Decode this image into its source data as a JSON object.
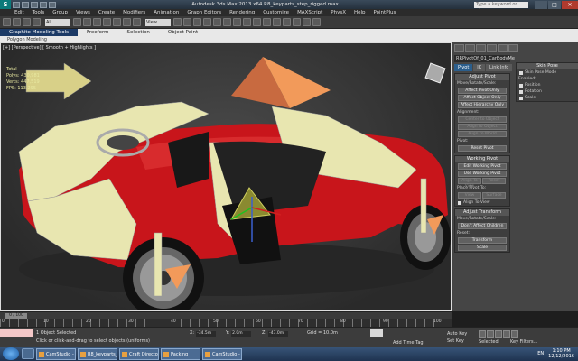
{
  "window": {
    "title": "Autodesk 3ds Max 2013 x64   R8_keyparts_step_rigged.max",
    "search_placeholder": "Type a keyword or phrase",
    "minimize": "–",
    "maximize": "□",
    "close": "✕"
  },
  "menu": [
    "Edit",
    "Tools",
    "Group",
    "Views",
    "Create",
    "Modifiers",
    "Animation",
    "Graph Editors",
    "Rendering",
    "Customize",
    "MAXScript",
    "PhysX",
    "Help",
    "PointPlus"
  ],
  "toolbar": {
    "dropdown_all": "All",
    "dropdown_view": "View"
  },
  "ribbon": {
    "tabs": [
      "Graphite Modeling Tools",
      "Freeform",
      "Selection",
      "Object Paint"
    ],
    "sub": "Polygon Modeling"
  },
  "viewport": {
    "label": "[+] [Perspective] [ Smooth + Highlights ]",
    "stats": {
      "total_label": "Total",
      "polys_label": "Polys:",
      "polys_value": "430,981",
      "verts_label": "Verts:",
      "verts_value": "447,519",
      "fps_label": "FPS:",
      "fps_value": "113.295"
    }
  },
  "command_panel": {
    "object_name": "RRPivotOf_01_CarBodyMe",
    "tabs": [
      "Pivot",
      "IK",
      "Link Info"
    ],
    "adjust_pivot": {
      "title": "Adjust Pivot",
      "move_label": "Move/Rotate/Scale:",
      "buttons": [
        "Affect Pivot Only",
        "Affect Object Only",
        "Affect Hierarchy Only"
      ],
      "alignment_label": "Alignment:",
      "align_buttons": [
        "Center to Object",
        "Align to Object",
        "Align to World"
      ],
      "pivot_label": "Pivot:",
      "reset_pivot": "Reset Pivot"
    },
    "working_pivot": {
      "title": "Working Pivot",
      "buttons": [
        "Edit Working Pivot",
        "Use Working Pivot"
      ],
      "align_row": [
        "Align To View",
        "Reset"
      ],
      "place_label": "Place Pivot To:",
      "place_row": [
        "View",
        "Surface"
      ],
      "align_to_view": "Align To View"
    },
    "adjust_transform": {
      "title": "Adjust Transform",
      "move_label": "Move/Rotate/Scale:",
      "dont_affect": "Don't Affect Children",
      "reset_label": "Reset:",
      "buttons": [
        "Transform",
        "Scale"
      ]
    },
    "skin_pose": {
      "title": "Skin Pose",
      "skin_pose_mode": "Skin Pose Mode",
      "enabled_label": "Enabled:",
      "options": [
        "Position",
        "Rotation",
        "Scale"
      ]
    }
  },
  "timeline": {
    "slider": "0 / 100",
    "ticks": [
      "0",
      "10",
      "20",
      "30",
      "40",
      "50",
      "60",
      "70",
      "80",
      "90",
      "100"
    ]
  },
  "status": {
    "selected": "1 Object Selected",
    "prompt": "Click or click-and-drag to select objects (uniforms)",
    "x_label": "X:",
    "x_value": "-34.5m",
    "y_label": "Y:",
    "y_value": "2.0m",
    "z_label": "Z:",
    "z_value": "-43.0m",
    "grid": "Grid = 10.0m",
    "auto_key": "Auto Key",
    "set_key": "Set Key",
    "selected_dd": "Selected",
    "key_filters": "Key Filters...",
    "add_time_tag": "Add Time Tag"
  },
  "taskbar": {
    "tasks": [
      "CamStudio - Free...",
      "R8_keyparts_step_1...",
      "Craft Director Stu...",
      "Packing",
      "CamStudio - Cust..."
    ],
    "lang": "EN",
    "time": "1:10 PM",
    "date": "12/12/2016"
  },
  "colors": {
    "car_body": "#c8151b",
    "car_parts": "#e8e6b0",
    "accent": "#f29a5a"
  }
}
